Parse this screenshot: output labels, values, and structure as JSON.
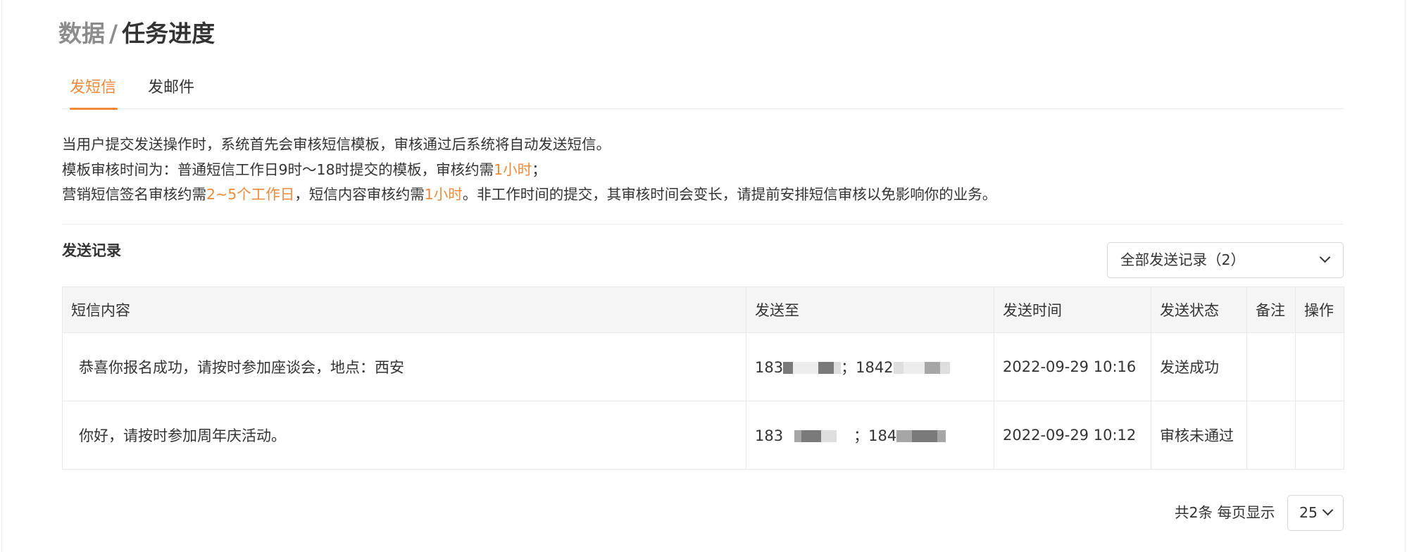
{
  "breadcrumb": {
    "parent": "数据",
    "separator": "/",
    "current": "任务进度"
  },
  "tabs": [
    {
      "label": "发短信",
      "active": true
    },
    {
      "label": "发邮件",
      "active": false
    }
  ],
  "notice": {
    "line1": "当用户提交发送操作时，系统首先会审核短信模板，审核通过后系统将自动发送短信。",
    "line2_prefix": "模板审核时间为：普通短信工作日9时～18时提交的模板，审核约需",
    "line2_highlight": "1小时",
    "line2_suffix": "；",
    "line3_prefix": "营销短信签名审核约需",
    "line3_highlight1": "2~5个工作日",
    "line3_mid": "，短信内容审核约需",
    "line3_highlight2": "1小时",
    "line3_suffix": "。非工作时间的提交，其审核时间会变长，请提前安排短信审核以免影响你的业务。"
  },
  "records": {
    "title": "发送记录",
    "filter_value": "全部发送记录（2）",
    "columns": [
      "短信内容",
      "发送至",
      "发送时间",
      "发送状态",
      "备注",
      "操作"
    ],
    "rows": [
      {
        "content": "恭喜你报名成功，请按时参加座谈会，地点：西安",
        "to_a": "183",
        "to_sep": "；",
        "to_b": "1842",
        "time": "2022-09-29 10:16",
        "status": "发送成功",
        "remark": "",
        "action": ""
      },
      {
        "content": "你好，请按时参加周年庆活动。",
        "to_a": "183",
        "to_sep": "；",
        "to_b": "184",
        "time": "2022-09-29 10:12",
        "status": "审核未通过",
        "remark": "",
        "action": ""
      }
    ]
  },
  "pagination": {
    "total_text": "共2条 每页显示",
    "page_size": "25"
  },
  "colors": {
    "accent": "#f0893b",
    "error": "#e8384f"
  }
}
